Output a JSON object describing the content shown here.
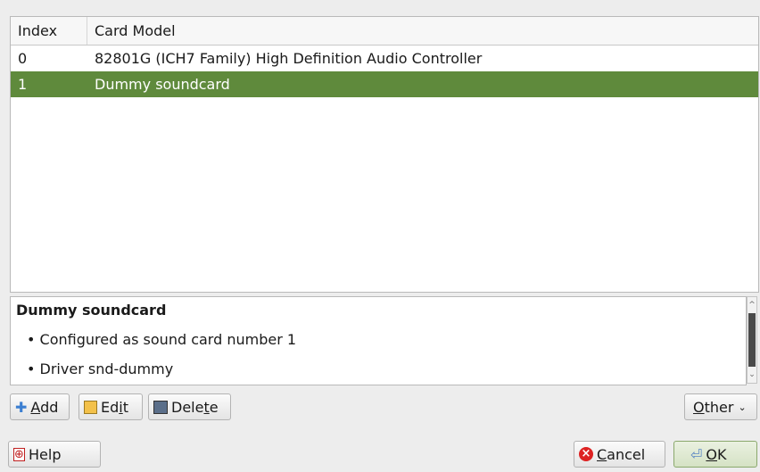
{
  "table": {
    "headers": [
      "Index",
      "Card Model"
    ],
    "rows": [
      {
        "index": "0",
        "model": "82801G (ICH7 Family) High Definition Audio Controller"
      },
      {
        "index": "1",
        "model": "Dummy soundcard"
      }
    ],
    "selected_index": 1
  },
  "details": {
    "title": "Dummy soundcard",
    "items": [
      "Configured as sound card number 1",
      "Driver snd-dummy"
    ]
  },
  "toolbar": {
    "add": {
      "pre": "",
      "key": "A",
      "post": "dd"
    },
    "edit": {
      "pre": "Ed",
      "key": "i",
      "post": "t"
    },
    "delete": {
      "pre": "Dele",
      "key": "t",
      "post": "e"
    },
    "other": {
      "pre": "",
      "key": "O",
      "post": "ther"
    }
  },
  "footer": {
    "help": "Help",
    "cancel": {
      "pre": "",
      "key": "C",
      "post": "ancel"
    },
    "ok": {
      "pre": "",
      "key": "O",
      "post": "K"
    }
  },
  "icons": {
    "add": "plus-icon",
    "edit": "edit-icon",
    "delete": "shredder-icon",
    "help": "help-icon",
    "cancel": "cancel-icon",
    "ok": "ok-arrow-icon"
  },
  "colors": {
    "selection": "#5f8a3c",
    "background": "#ededed"
  }
}
